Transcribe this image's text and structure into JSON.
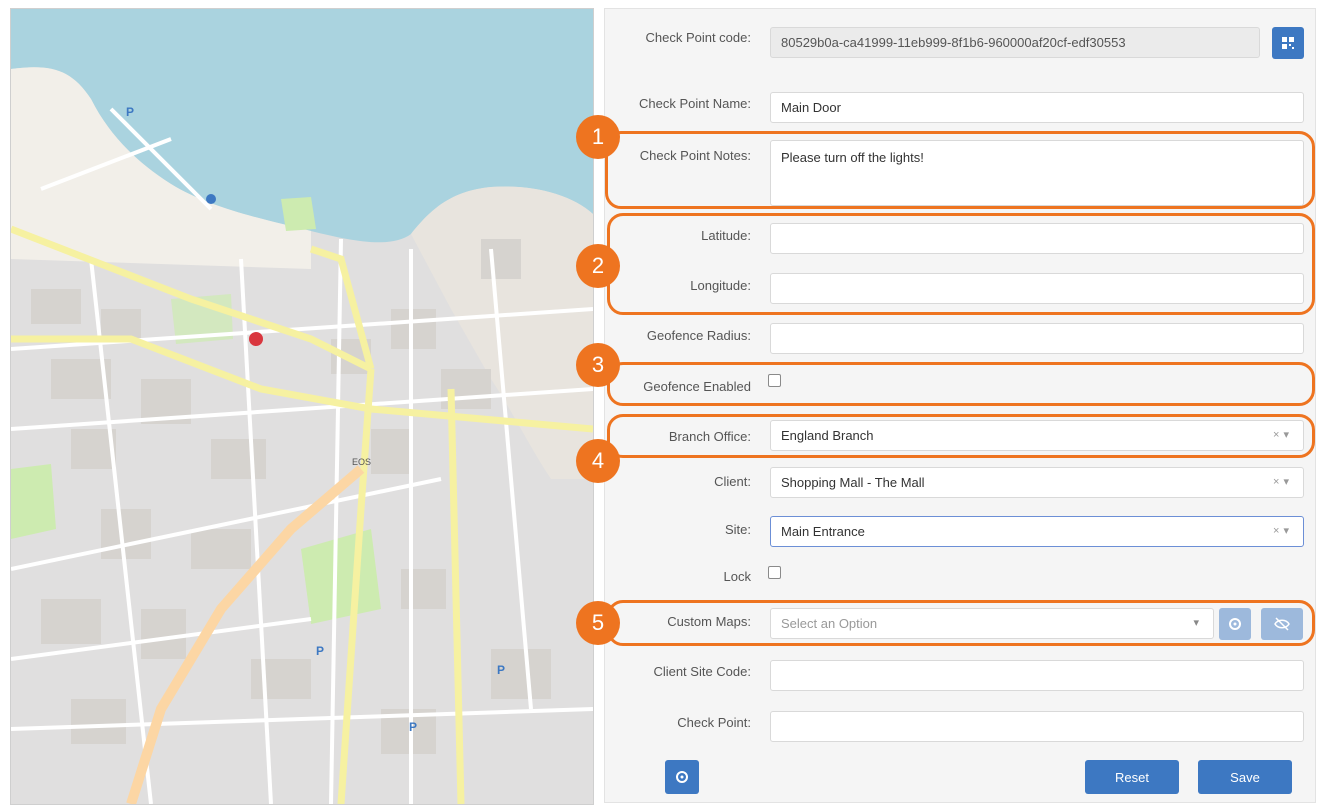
{
  "form": {
    "checkpoint_code": {
      "label": "Check Point code:",
      "value": "80529b0a-ca41999-11eb999-8f1b6-960000af20cf-edf30553"
    },
    "checkpoint_name": {
      "label": "Check Point Name:",
      "value": "Main Door"
    },
    "checkpoint_notes": {
      "label": "Check Point Notes:",
      "value": "Please turn off the lights!"
    },
    "latitude": {
      "label": "Latitude:",
      "value": ""
    },
    "longitude": {
      "label": "Longitude:",
      "value": ""
    },
    "geofence_radius": {
      "label": "Geofence Radius:",
      "value": ""
    },
    "geofence_enabled": {
      "label": "Geofence Enabled",
      "checked": false
    },
    "branch_office": {
      "label": "Branch Office:",
      "value": "England Branch"
    },
    "client": {
      "label": "Client:",
      "value": "Shopping Mall - The Mall"
    },
    "site": {
      "label": "Site:",
      "value": "Main Entrance"
    },
    "lock": {
      "label": "Lock",
      "checked": false
    },
    "custom_maps": {
      "label": "Custom Maps:",
      "placeholder": "Select an Option"
    },
    "client_site_code": {
      "label": "Client Site Code:",
      "value": ""
    },
    "check_point": {
      "label": "Check Point:",
      "value": ""
    }
  },
  "buttons": {
    "reset": "Reset",
    "save": "Save"
  },
  "annotations": [
    "1",
    "2",
    "3",
    "4",
    "5"
  ],
  "map": {
    "labels": [
      "EOS",
      "P",
      "P",
      "P",
      "P"
    ],
    "colors": {
      "sea": "#aad3df",
      "land": "#f2efe9",
      "urban": "#e0dfdf",
      "major_road": "#f6f1a1",
      "primary_road": "#fcd6a4",
      "park": "#cdebb0"
    }
  },
  "colors": {
    "accent": "#3d78c2",
    "annotation": "#ee7420"
  },
  "icons": [
    "qr-grid-icon",
    "locate-icon",
    "hide-icon",
    "crosshair-icon",
    "chevron-down-icon",
    "clear-icon"
  ]
}
